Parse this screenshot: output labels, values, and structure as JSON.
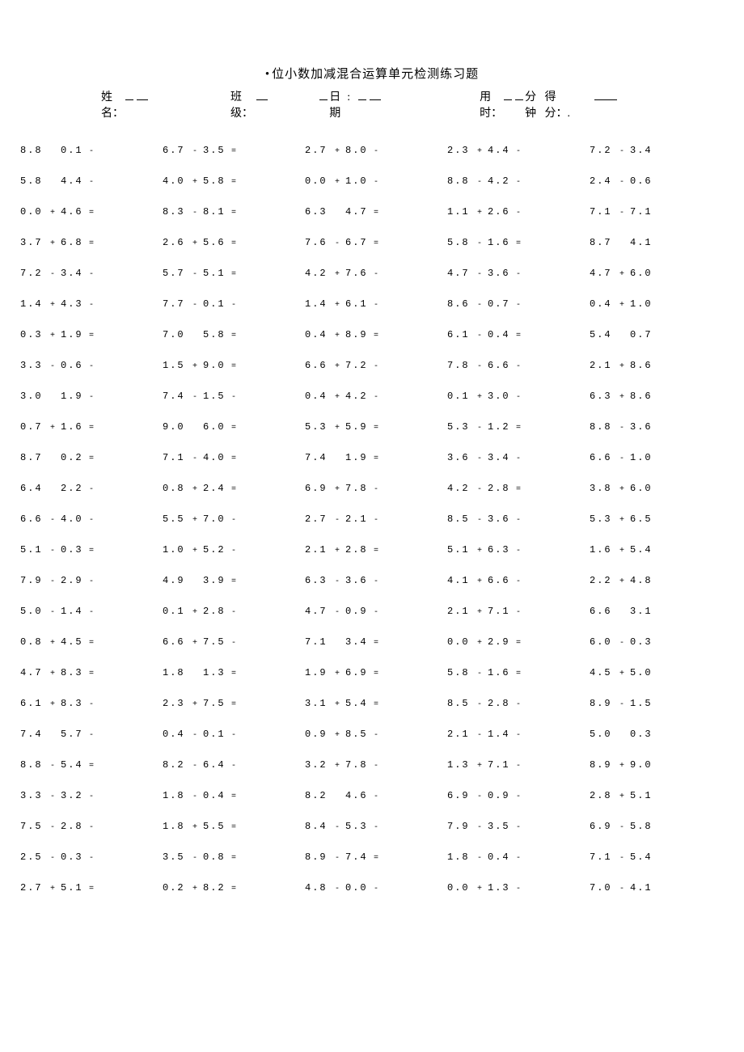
{
  "title_prefix": "•",
  "title": "位小数加减混合运算单元检测练习题",
  "header": {
    "name_label": "姓名：",
    "class_label": "班级：",
    "date_label": "日期",
    "time_label": "用时：",
    "time_unit": "分钟",
    "score_label": "得分：."
  },
  "rows": [
    [
      {
        "a": "8.8",
        "op": "",
        "b": "0.1",
        "eq": "-"
      },
      {
        "a": "6.7",
        "op": "-",
        "b": "3.5",
        "eq": "="
      },
      {
        "a": "2.7",
        "op": "+",
        "b": "8.0",
        "eq": "-"
      },
      {
        "a": "2.3",
        "op": "+",
        "b": "4.4",
        "eq": "-"
      },
      {
        "a": "7.2",
        "op": "-",
        "b": "3.4",
        "eq": ""
      }
    ],
    [
      {
        "a": "5.8",
        "op": "",
        "b": "4.4",
        "eq": "-"
      },
      {
        "a": "4.0",
        "op": "+",
        "b": "5.8",
        "eq": "="
      },
      {
        "a": "0.0",
        "op": "+",
        "b": "1.0",
        "eq": "-"
      },
      {
        "a": "8.8",
        "op": "-",
        "b": "4.2",
        "eq": "-"
      },
      {
        "a": "2.4",
        "op": "-",
        "b": "0.6",
        "eq": ""
      }
    ],
    [
      {
        "a": "0.0",
        "op": "+",
        "b": "4.6",
        "eq": "="
      },
      {
        "a": "8.3",
        "op": "-",
        "b": "8.1",
        "eq": "="
      },
      {
        "a": "6.3",
        "op": "",
        "b": "4.7",
        "eq": "="
      },
      {
        "a": "1.1",
        "op": "+",
        "b": "2.6",
        "eq": "-"
      },
      {
        "a": "7.1",
        "op": "-",
        "b": "7.1",
        "eq": ""
      }
    ],
    [
      {
        "a": "3.7",
        "op": "+",
        "b": "6.8",
        "eq": "="
      },
      {
        "a": "2.6",
        "op": "+",
        "b": "5.6",
        "eq": "="
      },
      {
        "a": "7.6",
        "op": "-",
        "b": "6.7",
        "eq": "="
      },
      {
        "a": "5.8",
        "op": "-",
        "b": "1.6",
        "eq": "="
      },
      {
        "a": "8.7",
        "op": "",
        "b": "4.1",
        "eq": ""
      }
    ],
    [
      {
        "a": "7.2",
        "op": "-",
        "b": "3.4",
        "eq": "-"
      },
      {
        "a": "5.7",
        "op": "-",
        "b": "5.1",
        "eq": "="
      },
      {
        "a": "4.2",
        "op": "+",
        "b": "7.6",
        "eq": "-"
      },
      {
        "a": "4.7",
        "op": "-",
        "b": "3.6",
        "eq": "-"
      },
      {
        "a": "4.7",
        "op": "+",
        "b": "6.0",
        "eq": ""
      }
    ],
    [
      {
        "a": "1.4",
        "op": "+",
        "b": "4.3",
        "eq": "-"
      },
      {
        "a": "7.7",
        "op": "-",
        "b": "0.1",
        "eq": "-"
      },
      {
        "a": "1.4",
        "op": "+",
        "b": "6.1",
        "eq": "-"
      },
      {
        "a": "8.6",
        "op": "-",
        "b": "0.7",
        "eq": "-"
      },
      {
        "a": "0.4",
        "op": "+",
        "b": "1.0",
        "eq": ""
      }
    ],
    [
      {
        "a": "0.3",
        "op": "+",
        "b": "1.9",
        "eq": "="
      },
      {
        "a": "7.0",
        "op": "",
        "b": "5.8",
        "eq": "="
      },
      {
        "a": "0.4",
        "op": "+",
        "b": "8.9",
        "eq": "="
      },
      {
        "a": "6.1",
        "op": "-",
        "b": "0.4",
        "eq": "="
      },
      {
        "a": "5.4",
        "op": "",
        "b": "0.7",
        "eq": ""
      }
    ],
    [
      {
        "a": "3.3",
        "op": "-",
        "b": "0.6",
        "eq": "-"
      },
      {
        "a": "1.5",
        "op": "+",
        "b": "9.0",
        "eq": "="
      },
      {
        "a": "6.6",
        "op": "+",
        "b": "7.2",
        "eq": "-"
      },
      {
        "a": "7.8",
        "op": "-",
        "b": "6.6",
        "eq": "-"
      },
      {
        "a": "2.1",
        "op": "+",
        "b": "8.6",
        "eq": ""
      }
    ],
    [
      {
        "a": "3.0",
        "op": "",
        "b": "1.9",
        "eq": "-"
      },
      {
        "a": "7.4",
        "op": "-",
        "b": "1.5",
        "eq": "-"
      },
      {
        "a": "0.4",
        "op": "+",
        "b": "4.2",
        "eq": "-"
      },
      {
        "a": "0.1",
        "op": "+",
        "b": "3.0",
        "eq": "-"
      },
      {
        "a": "6.3",
        "op": "+",
        "b": "8.6",
        "eq": ""
      }
    ],
    [
      {
        "a": "0.7",
        "op": "+",
        "b": "1.6",
        "eq": "="
      },
      {
        "a": "9.0",
        "op": "",
        "b": "6.0",
        "eq": "="
      },
      {
        "a": "5.3",
        "op": "+",
        "b": "5.9",
        "eq": "="
      },
      {
        "a": "5.3",
        "op": "-",
        "b": "1.2",
        "eq": "="
      },
      {
        "a": "8.8",
        "op": "-",
        "b": "3.6",
        "eq": ""
      }
    ],
    [
      {
        "a": "8.7",
        "op": "",
        "b": "0.2",
        "eq": "="
      },
      {
        "a": "7.1",
        "op": "-",
        "b": "4.0",
        "eq": "="
      },
      {
        "a": "7.4",
        "op": "",
        "b": "1.9",
        "eq": "="
      },
      {
        "a": "3.6",
        "op": "-",
        "b": "3.4",
        "eq": "-"
      },
      {
        "a": "6.6",
        "op": "-",
        "b": "1.0",
        "eq": ""
      }
    ],
    [
      {
        "a": "6.4",
        "op": "",
        "b": "2.2",
        "eq": "-"
      },
      {
        "a": "0.8",
        "op": "+",
        "b": "2.4",
        "eq": "="
      },
      {
        "a": "6.9",
        "op": "+",
        "b": "7.8",
        "eq": "-"
      },
      {
        "a": "4.2",
        "op": "-",
        "b": "2.8",
        "eq": "="
      },
      {
        "a": "3.8",
        "op": "+",
        "b": "6.0",
        "eq": ""
      }
    ],
    [
      {
        "a": "6.6",
        "op": "-",
        "b": "4.0",
        "eq": "-"
      },
      {
        "a": "5.5",
        "op": "+",
        "b": "7.0",
        "eq": "-"
      },
      {
        "a": "2.7",
        "op": "-",
        "b": "2.1",
        "eq": "-"
      },
      {
        "a": "8.5",
        "op": "-",
        "b": "3.6",
        "eq": "-"
      },
      {
        "a": "5.3",
        "op": "+",
        "b": "6.5",
        "eq": ""
      }
    ],
    [
      {
        "a": "5.1",
        "op": "-",
        "b": "0.3",
        "eq": "="
      },
      {
        "a": "1.0",
        "op": "+",
        "b": "5.2",
        "eq": "-"
      },
      {
        "a": "2.1",
        "op": "+",
        "b": "2.8",
        "eq": "="
      },
      {
        "a": "5.1",
        "op": "+",
        "b": "6.3",
        "eq": "-"
      },
      {
        "a": "1.6",
        "op": "+",
        "b": "5.4",
        "eq": ""
      }
    ],
    [
      {
        "a": "7.9",
        "op": "-",
        "b": "2.9",
        "eq": "-"
      },
      {
        "a": "4.9",
        "op": "",
        "b": "3.9",
        "eq": "="
      },
      {
        "a": "6.3",
        "op": "-",
        "b": "3.6",
        "eq": "-"
      },
      {
        "a": "4.1",
        "op": "+",
        "b": "6.6",
        "eq": "-"
      },
      {
        "a": "2.2",
        "op": "+",
        "b": "4.8",
        "eq": ""
      }
    ],
    [
      {
        "a": "5.0",
        "op": "-",
        "b": "1.4",
        "eq": "-"
      },
      {
        "a": "0.1",
        "op": "+",
        "b": "2.8",
        "eq": "-"
      },
      {
        "a": "4.7",
        "op": "-",
        "b": "0.9",
        "eq": "-"
      },
      {
        "a": "2.1",
        "op": "+",
        "b": "7.1",
        "eq": "-"
      },
      {
        "a": "6.6",
        "op": "",
        "b": "3.1",
        "eq": ""
      }
    ],
    [
      {
        "a": "0.8",
        "op": "+",
        "b": "4.5",
        "eq": "="
      },
      {
        "a": "6.6",
        "op": "+",
        "b": "7.5",
        "eq": "-"
      },
      {
        "a": "7.1",
        "op": "",
        "b": "3.4",
        "eq": "="
      },
      {
        "a": "0.0",
        "op": "+",
        "b": "2.9",
        "eq": "="
      },
      {
        "a": "6.0",
        "op": "-",
        "b": "0.3",
        "eq": ""
      }
    ],
    [
      {
        "a": "4.7",
        "op": "+",
        "b": "8.3",
        "eq": "="
      },
      {
        "a": "1.8",
        "op": "",
        "b": "1.3",
        "eq": "="
      },
      {
        "a": "1.9",
        "op": "+",
        "b": "6.9",
        "eq": "="
      },
      {
        "a": "5.8",
        "op": "-",
        "b": "1.6",
        "eq": "="
      },
      {
        "a": "4.5",
        "op": "+",
        "b": "5.0",
        "eq": ""
      }
    ],
    [
      {
        "a": "6.1",
        "op": "+",
        "b": "8.3",
        "eq": "-"
      },
      {
        "a": "2.3",
        "op": "+",
        "b": "7.5",
        "eq": "="
      },
      {
        "a": "3.1",
        "op": "+",
        "b": "5.4",
        "eq": "="
      },
      {
        "a": "8.5",
        "op": "-",
        "b": "2.8",
        "eq": "-"
      },
      {
        "a": "8.9",
        "op": "-",
        "b": "1.5",
        "eq": ""
      }
    ],
    [
      {
        "a": "7.4",
        "op": "",
        "b": "5.7",
        "eq": "-"
      },
      {
        "a": "0.4",
        "op": "-",
        "b": "0.1",
        "eq": "-"
      },
      {
        "a": "0.9",
        "op": "+",
        "b": "8.5",
        "eq": "-"
      },
      {
        "a": "2.1",
        "op": "-",
        "b": "1.4",
        "eq": "-"
      },
      {
        "a": "5.0",
        "op": "",
        "b": "0.3",
        "eq": ""
      }
    ],
    [
      {
        "a": "8.8",
        "op": "-",
        "b": "5.4",
        "eq": "="
      },
      {
        "a": "8.2",
        "op": "-",
        "b": "6.4",
        "eq": "-"
      },
      {
        "a": "3.2",
        "op": "+",
        "b": "7.8",
        "eq": "-"
      },
      {
        "a": "1.3",
        "op": "+",
        "b": "7.1",
        "eq": "-"
      },
      {
        "a": "8.9",
        "op": "+",
        "b": "9.0",
        "eq": ""
      }
    ],
    [
      {
        "a": "3.3",
        "op": "-",
        "b": "3.2",
        "eq": "-"
      },
      {
        "a": "1.8",
        "op": "-",
        "b": "0.4",
        "eq": "="
      },
      {
        "a": "8.2",
        "op": "",
        "b": "4.6",
        "eq": "-"
      },
      {
        "a": "6.9",
        "op": "-",
        "b": "0.9",
        "eq": "-"
      },
      {
        "a": "2.8",
        "op": "+",
        "b": "5.1",
        "eq": ""
      }
    ],
    [
      {
        "a": "7.5",
        "op": "-",
        "b": "2.8",
        "eq": "-"
      },
      {
        "a": "1.8",
        "op": "+",
        "b": "5.5",
        "eq": "="
      },
      {
        "a": "8.4",
        "op": "-",
        "b": "5.3",
        "eq": "-"
      },
      {
        "a": "7.9",
        "op": "-",
        "b": "3.5",
        "eq": "-"
      },
      {
        "a": "6.9",
        "op": "-",
        "b": "5.8",
        "eq": ""
      }
    ],
    [
      {
        "a": "2.5",
        "op": "-",
        "b": "0.3",
        "eq": "-"
      },
      {
        "a": "3.5",
        "op": "-",
        "b": "0.8",
        "eq": "="
      },
      {
        "a": "8.9",
        "op": "-",
        "b": "7.4",
        "eq": "="
      },
      {
        "a": "1.8",
        "op": "-",
        "b": "0.4",
        "eq": "-"
      },
      {
        "a": "7.1",
        "op": "-",
        "b": "5.4",
        "eq": ""
      }
    ],
    [
      {
        "a": "2.7",
        "op": "+",
        "b": "5.1",
        "eq": "="
      },
      {
        "a": "0.2",
        "op": "+",
        "b": "8.2",
        "eq": "="
      },
      {
        "a": "4.8",
        "op": "-",
        "b": "0.0",
        "eq": "-"
      },
      {
        "a": "0.0",
        "op": "+",
        "b": "1.3",
        "eq": "-"
      },
      {
        "a": "7.0",
        "op": "-",
        "b": "4.1",
        "eq": ""
      }
    ]
  ]
}
